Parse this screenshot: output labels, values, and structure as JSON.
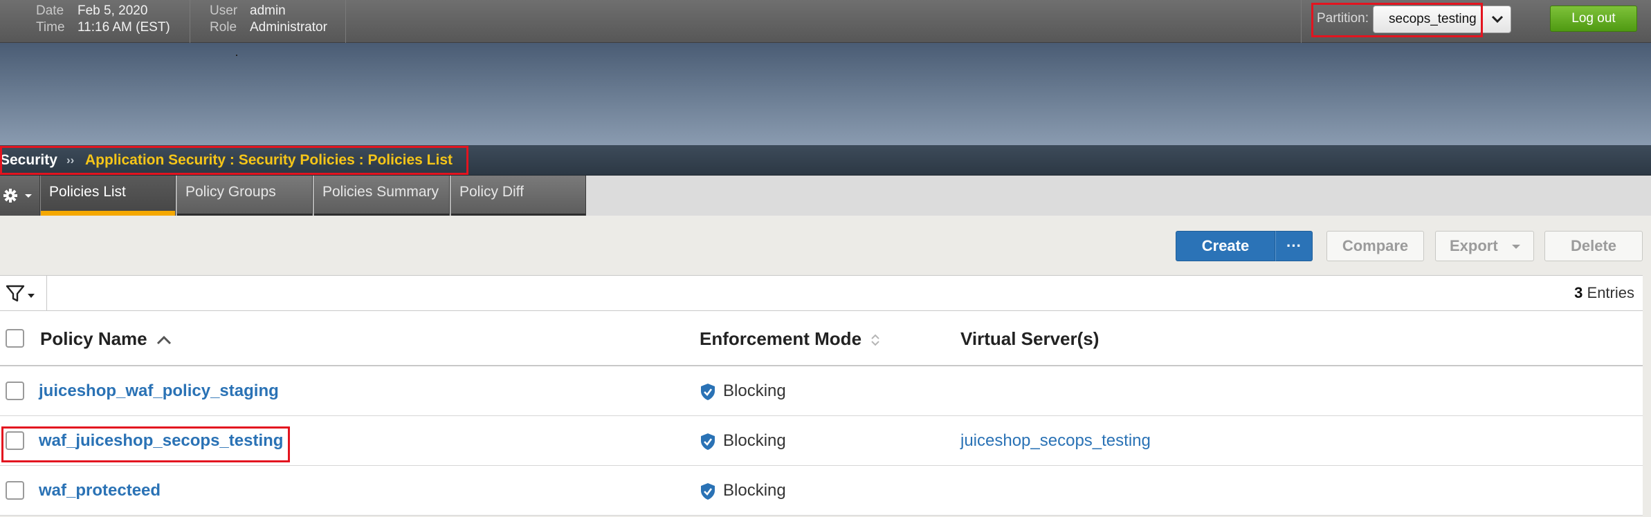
{
  "header": {
    "date_label": "Date",
    "date_value": "Feb 5, 2020",
    "time_label": "Time",
    "time_value": "11:16 AM (EST)",
    "user_label": "User",
    "user_value": "admin",
    "role_label": "Role",
    "role_value": "Administrator",
    "partition_label": "Partition:",
    "partition_value": "secops_testing",
    "logout_label": "Log out"
  },
  "breadcrumb": {
    "root": "Security",
    "separator": "››",
    "path": "Application Security : Security Policies : Policies List"
  },
  "tabs": [
    {
      "label": "Policies List",
      "active": true
    },
    {
      "label": "Policy Groups",
      "active": false
    },
    {
      "label": "Policies Summary",
      "active": false
    },
    {
      "label": "Policy Diff",
      "active": false
    }
  ],
  "toolbar": {
    "create_label": "Create",
    "more_label": "···",
    "compare_label": "Compare",
    "export_label": "Export",
    "delete_label": "Delete"
  },
  "filter": {
    "entries_count": "3",
    "entries_label": "Entries"
  },
  "table": {
    "columns": [
      "Policy Name",
      "Enforcement Mode",
      "Virtual Server(s)"
    ],
    "rows": [
      {
        "policy_name": "juiceshop_waf_policy_staging",
        "enforcement_mode": "Blocking",
        "virtual_servers": ""
      },
      {
        "policy_name": "waf_juiceshop_secops_testing",
        "enforcement_mode": "Blocking",
        "virtual_servers": "juiceshop_secops_testing"
      },
      {
        "policy_name": "waf_protecteed",
        "enforcement_mode": "Blocking",
        "virtual_servers": ""
      }
    ]
  },
  "colors": {
    "accent": "#2b73b7",
    "breadcrumb_path": "#f5c518",
    "active_tab_underline": "#f5a800",
    "logout": "#5aa81c",
    "highlight": "#e3141f"
  },
  "icons": {
    "gear": "gear-icon",
    "filter": "filter-icon",
    "sort_asc": "sort-ascending-icon",
    "sort_both": "sort-icon",
    "shield": "shield-check-icon",
    "chevron": "chevron-down-icon"
  }
}
